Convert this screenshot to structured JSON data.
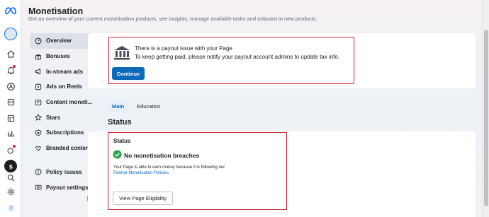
{
  "header": {
    "title": "Monetisation",
    "subtitle": "Get an overview of your current monetisation products, see insights, manage available tasks and onboard to new products."
  },
  "nav": {
    "items": [
      {
        "label": "Overview",
        "icon": "gauge-icon",
        "selected": true
      },
      {
        "label": "Bonuses",
        "icon": "gift-icon"
      },
      {
        "label": "In-stream ads",
        "icon": "megaphone-icon"
      },
      {
        "label": "Ads on Reels",
        "icon": "reels-icon"
      },
      {
        "label": "Content moneti...",
        "icon": "content-icon"
      },
      {
        "label": "Stars",
        "icon": "star-icon"
      },
      {
        "label": "Subscriptions",
        "icon": "shield-star-icon"
      },
      {
        "label": "Branded content",
        "icon": "handshake-icon"
      }
    ],
    "bottom_items": [
      {
        "label": "Policy issues",
        "icon": "alert-circle-icon"
      },
      {
        "label": "Payout settings",
        "icon": "payout-icon"
      }
    ]
  },
  "alert": {
    "title": "There is a payout issue with your Page",
    "text": "To keep getting paid, please notify your payout account admins to update tax info.",
    "button": "Continue"
  },
  "tabs": [
    {
      "label": "Main",
      "active": true
    },
    {
      "label": "Education",
      "active": false
    }
  ],
  "status": {
    "heading": "Status",
    "card_title": "Status",
    "breach_label": "No monetisation breaches",
    "text": "Your Page is able to earn money because it is following our",
    "link": "Partner Monetisation Policies.",
    "button": "View Page Eligibility"
  },
  "colors": {
    "accent": "#0e6ab8",
    "highlight_border": "#c8282f",
    "success": "#31a24c"
  }
}
